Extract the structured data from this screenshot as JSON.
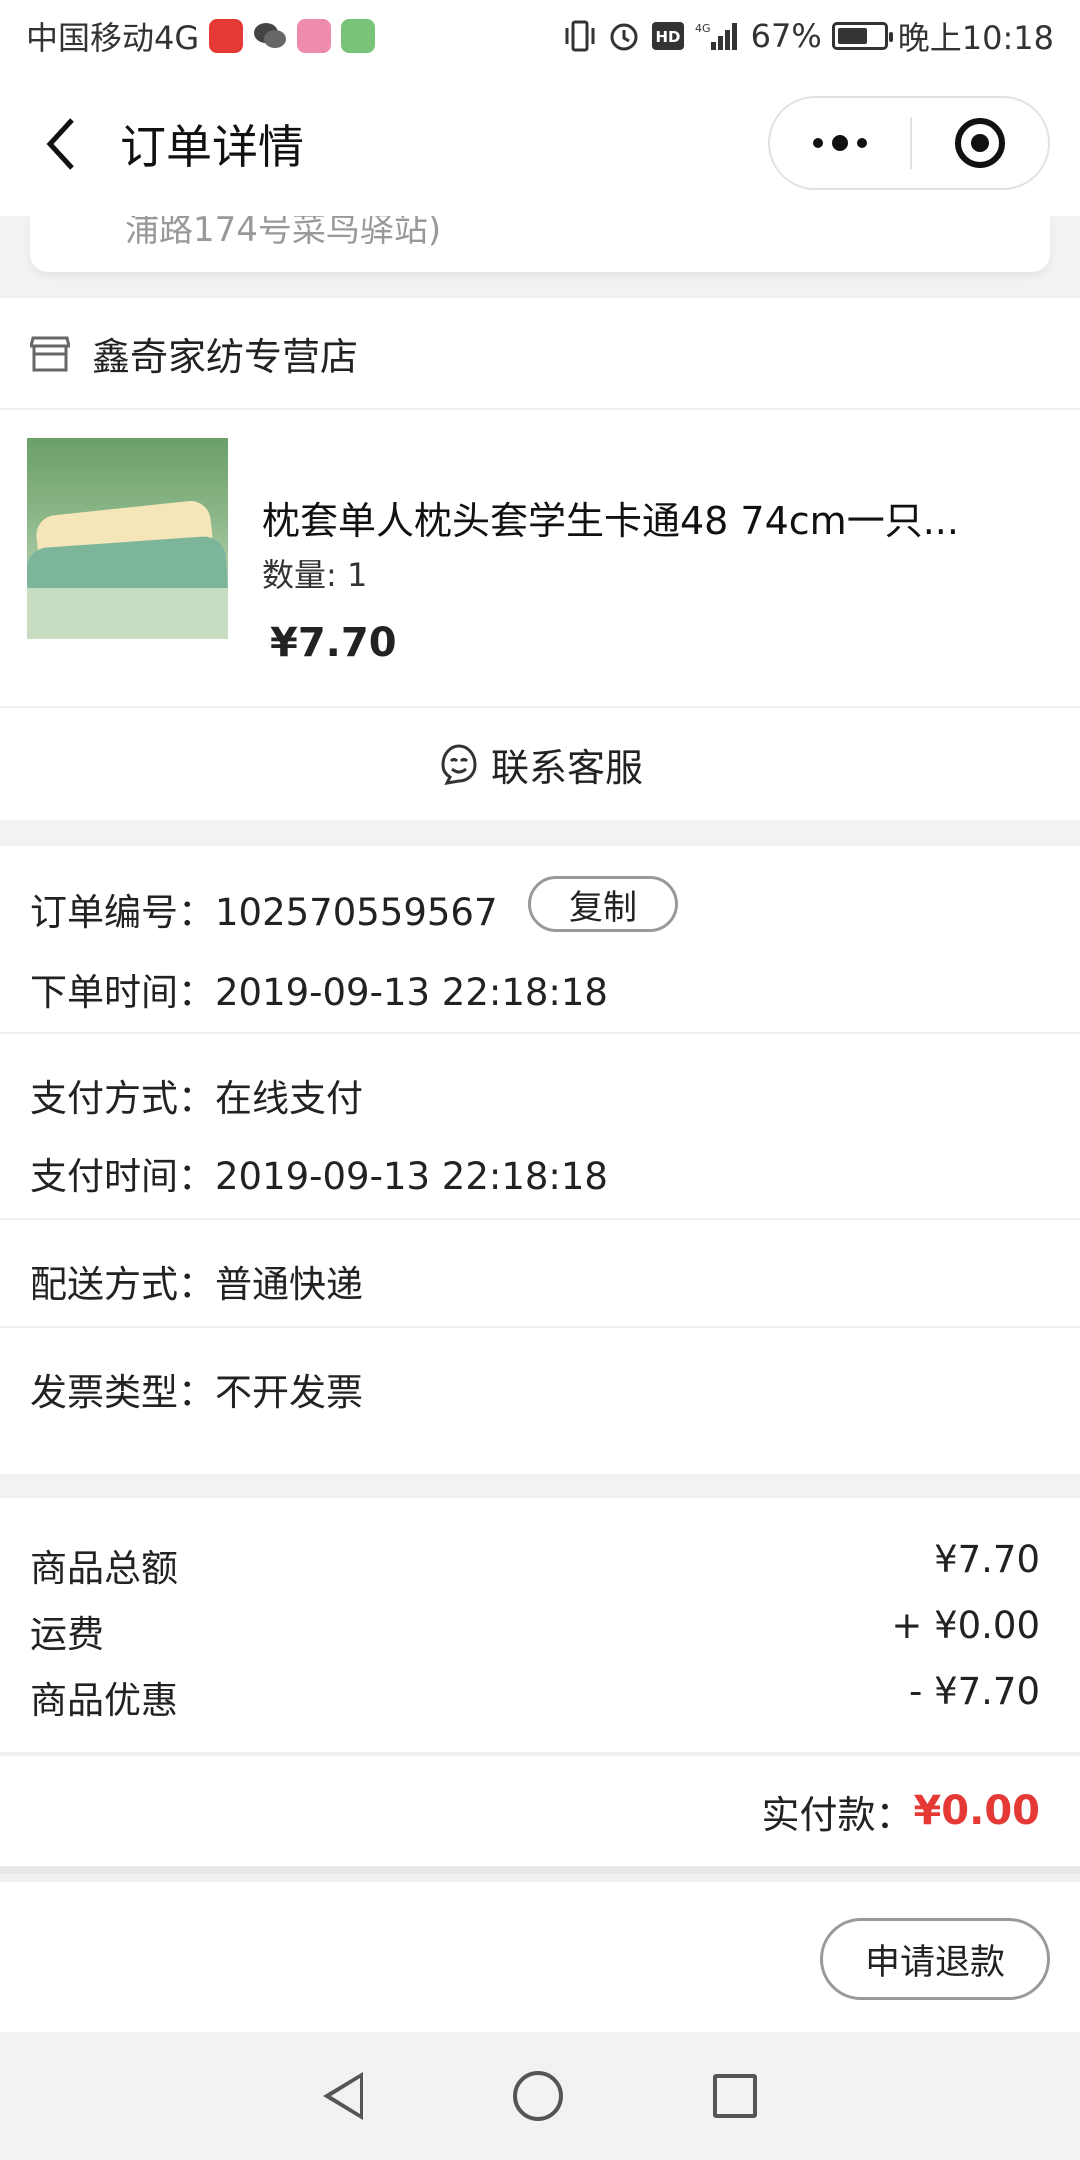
{
  "status_bar": {
    "carrier": "中国移动4G",
    "battery": "67%",
    "battery_level": 0.67,
    "time": "晚上10:18"
  },
  "header": {
    "title": "订单详情"
  },
  "address": {
    "partial_text": "浦路174号菜鸟驿站)"
  },
  "store": {
    "name": "鑫奇家纺专营店"
  },
  "product": {
    "title": "枕套单人枕头套学生卡通48 74cm一只...",
    "quantity": "数量: 1",
    "price": "¥7.70"
  },
  "service": {
    "label": "联系客服"
  },
  "order_info": {
    "order_no_label": "订单编号：",
    "order_no": "102570559567",
    "copy_label": "复制",
    "order_time_label": "下单时间：",
    "order_time": "2019-09-13 22:18:18",
    "pay_method_label": "支付方式：",
    "pay_method": "在线支付",
    "pay_time_label": "支付时间：",
    "pay_time": "2019-09-13 22:18:18",
    "delivery_label": "配送方式：",
    "delivery": "普通快递",
    "invoice_label": "发票类型：",
    "invoice": "不开发票"
  },
  "summary": {
    "rows": [
      {
        "label": "商品总额",
        "value": "¥7.70"
      },
      {
        "label": "运费",
        "value": "+ ¥0.00"
      },
      {
        "label": "商品优惠",
        "value": "- ¥7.70"
      }
    ],
    "payable_label": "实付款：",
    "payable_value": "¥0.00"
  },
  "actions": {
    "refund_label": "申请退款"
  },
  "colors": {
    "accent_red": "#e53935"
  }
}
